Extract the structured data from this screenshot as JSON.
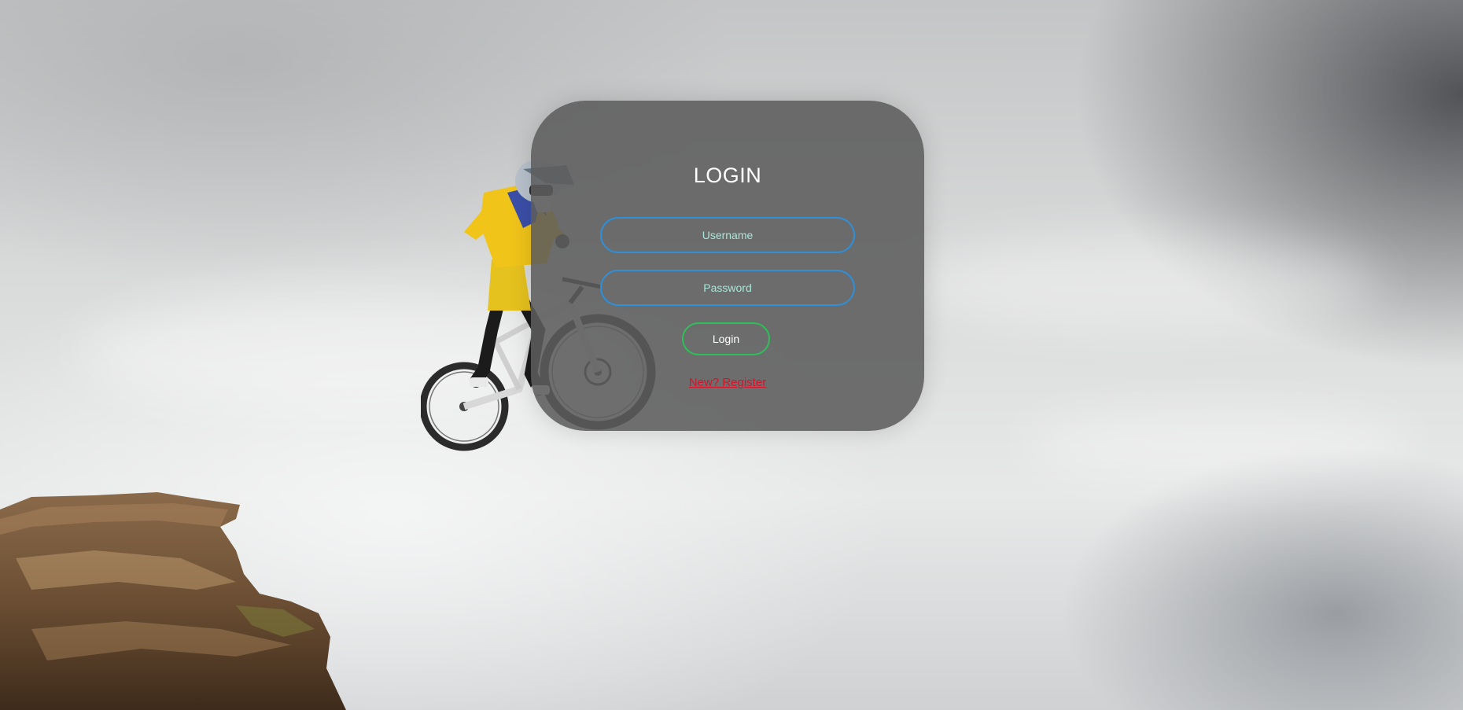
{
  "window": {
    "background_scene": "mountain-biker-jumping-off-cliff"
  },
  "login_card": {
    "title": "LOGIN",
    "username": {
      "placeholder": "Username",
      "value": ""
    },
    "password": {
      "placeholder": "Password",
      "value": ""
    },
    "login_button_label": "Login",
    "register_link_label": "New? Register"
  },
  "colors": {
    "card_background": "#5c5c5c",
    "input_border": "#2f8fd8",
    "input_placeholder": "#a9e6d8",
    "login_button_border": "#2fbf5a",
    "register_link": "#d4142a",
    "title_text": "#ffffff"
  }
}
